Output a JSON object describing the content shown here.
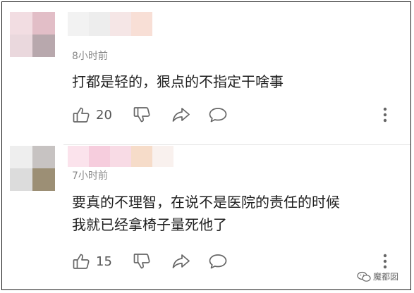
{
  "comments": [
    {
      "avatar_colors": [
        "#f2dde2",
        "#e2bec7",
        "#ead8dd",
        "#b8a8ad"
      ],
      "username_colors": [
        "#f2f2f2",
        "#ededed",
        "#f5e6e6",
        "#f8dfd6"
      ],
      "time": "8小时前",
      "text_lines": [
        "打都是轻的，狠点的不指定干啥事"
      ],
      "likes": "20"
    },
    {
      "avatar_colors": [
        "#eeeeee",
        "#c7c3c2",
        "#dcdcdc",
        "#9c8f75"
      ],
      "username_colors": [
        "#fbe3ec",
        "#f6cddd",
        "#f8dbe5",
        "#f6dcc9",
        "#f9f1ee"
      ],
      "time": "7小时前",
      "text_lines": [
        "要真的不理智，在说不是医院的责任的时候",
        "我就已经拿椅子量死他了"
      ],
      "likes": "15"
    }
  ],
  "watermark": {
    "text": "魔都囡"
  },
  "icons": [
    "thumbs-up-icon",
    "thumbs-down-icon",
    "share-icon",
    "reply-bubble-icon",
    "more-vertical-icon"
  ],
  "colors": {
    "text": "#1f1f1f",
    "muted": "#8a8a8a",
    "icon": "#666666"
  }
}
